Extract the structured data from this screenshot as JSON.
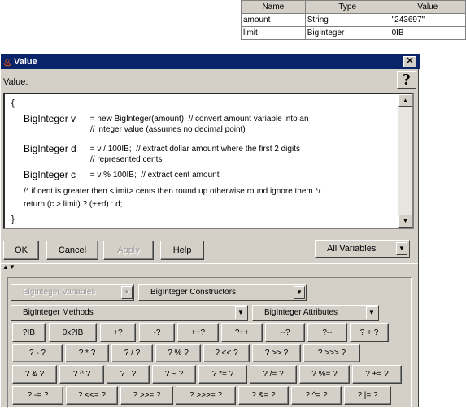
{
  "variables_table": {
    "headers": [
      "Name",
      "Type",
      "Value"
    ],
    "rows": [
      [
        "amount",
        "String",
        "\"243697\""
      ],
      [
        "limit",
        "BigInteger",
        "0IB"
      ]
    ]
  },
  "dialog": {
    "title": "Value",
    "close_glyph": "✕",
    "value_label": "Value:",
    "help_glyph": "?",
    "code": {
      "open_brace": "{",
      "line1_decl": "BigInteger v",
      "line1_rest": " = new BigInteger(amount); // convert amount variable into an",
      "line1_cont": "// integer value (assumes no decimal point)",
      "line2_decl": "BigInteger d",
      "line2_rest": " = v / 100IB;  // extract dollar amount where the first 2 digits",
      "line2_cont": "// represented cents",
      "line3_decl": "BigInteger c",
      "line3_rest": " = v % 100IB;  // extract cent amount",
      "comment": "/* if cent is greater then <limit> cents then round up otherwise round ignore them */",
      "return_stmt": "return (c > limit) ? (++d) : d;",
      "close_brace": "}"
    },
    "buttons": {
      "ok": "OK",
      "cancel": "Cancel",
      "apply": "Apply",
      "help": "Help"
    },
    "scope_select": "All Variables",
    "builder": {
      "variables_select": "BigInteger Variables",
      "constructors_select": "BigInteger Constructors",
      "methods_select": "BigInteger Methods",
      "attributes_select": "BigInteger Attributes",
      "row1": [
        "?IB",
        "0x?IB",
        "+?",
        "-?",
        "++?",
        "?++",
        "--?",
        "?--",
        "? + ?"
      ],
      "row2": [
        "? - ?",
        "? * ?",
        "? / ?",
        "? % ?",
        "? << ?",
        "? >> ?",
        "? >>> ?"
      ],
      "row3": [
        "? & ?",
        "? ^ ?",
        "? | ?",
        "? ~ ?",
        "? *= ?",
        "? /= ?",
        "? %= ?",
        "? += ?"
      ],
      "row4": [
        "? -= ?",
        "? <<= ?",
        "? >>= ?",
        "? >>>= ?",
        "? &= ?",
        "? ^= ?",
        "? |= ?"
      ]
    }
  }
}
